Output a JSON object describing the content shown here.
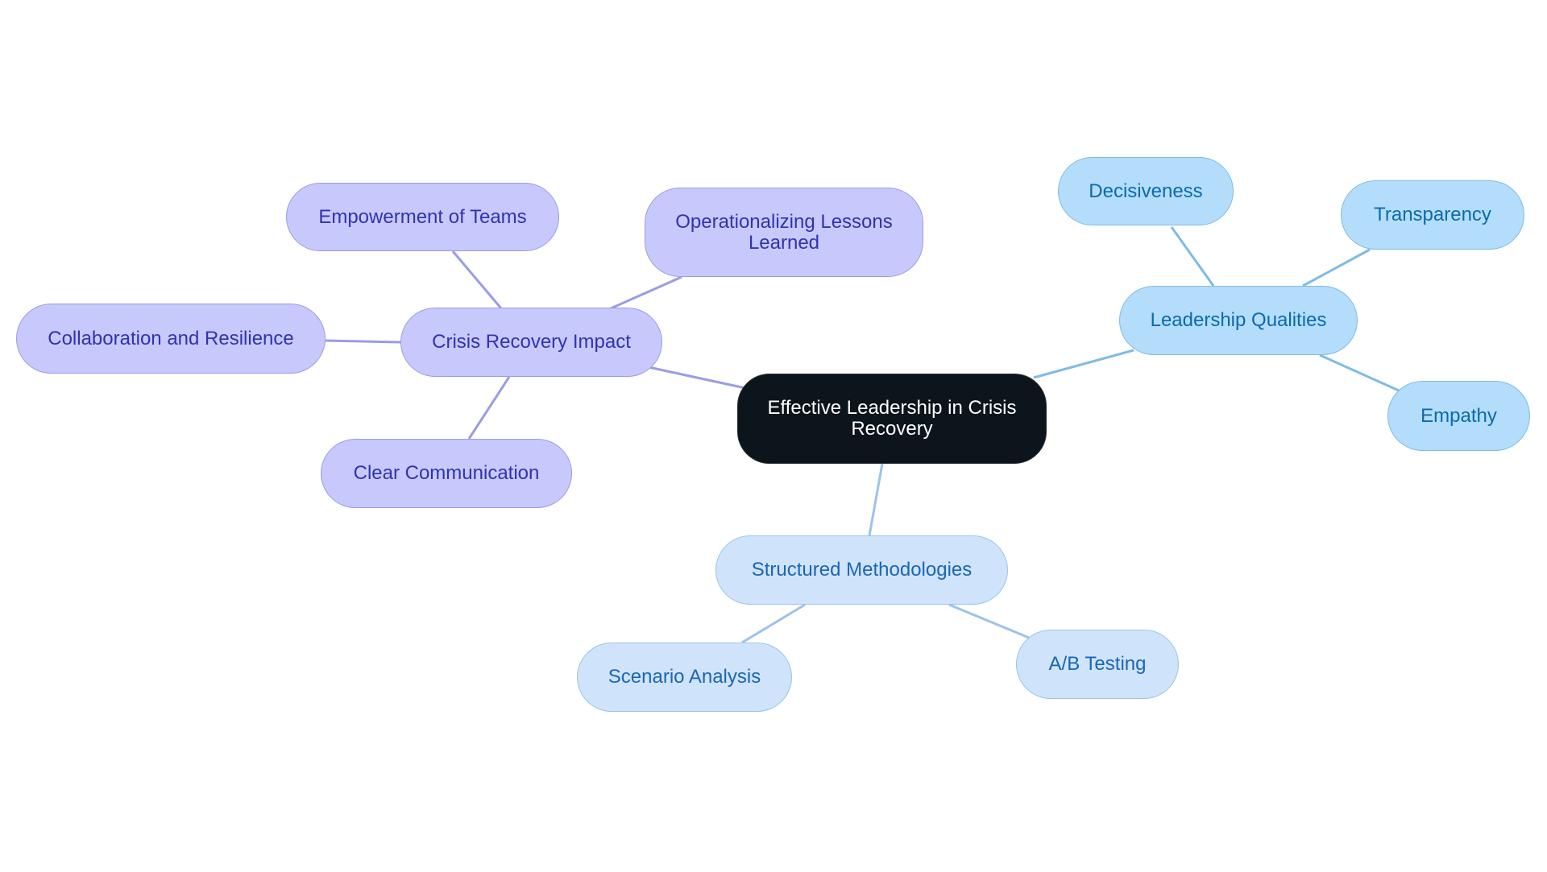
{
  "diagram": {
    "type": "mind-map",
    "root": {
      "id": "root",
      "label": "Effective Leadership in Crisis Recovery",
      "style": "root"
    },
    "colors": {
      "root_fill": "#0c141c",
      "purple_fill": "#c7c9fd",
      "purple_text": "#3033b0",
      "purple_edge": "#9a9ce6",
      "sky_fill": "#b3ddfb",
      "sky_text": "#0c6aad",
      "sky_edge": "#7ebbe6",
      "pale_fill": "#cfe3fb",
      "pale_text": "#1a66b4",
      "pale_edge": "#9cc2ec"
    },
    "nodes": [
      {
        "id": "crisis",
        "label": "Crisis Recovery Impact",
        "parent": "root",
        "style": "purple"
      },
      {
        "id": "empower",
        "label": "Empowerment of Teams",
        "parent": "crisis",
        "style": "purple"
      },
      {
        "id": "oplessons",
        "label": "Operationalizing Lessons Learned",
        "parent": "crisis",
        "style": "purple"
      },
      {
        "id": "collab",
        "label": "Collaboration and Resilience",
        "parent": "crisis",
        "style": "purple"
      },
      {
        "id": "clearcomm",
        "label": "Clear Communication",
        "parent": "crisis",
        "style": "purple"
      },
      {
        "id": "leadq",
        "label": "Leadership Qualities",
        "parent": "root",
        "style": "sky"
      },
      {
        "id": "decisive",
        "label": "Decisiveness",
        "parent": "leadq",
        "style": "sky"
      },
      {
        "id": "transp",
        "label": "Transparency",
        "parent": "leadq",
        "style": "sky"
      },
      {
        "id": "empathy",
        "label": "Empathy",
        "parent": "leadq",
        "style": "sky"
      },
      {
        "id": "structured",
        "label": "Structured Methodologies",
        "parent": "root",
        "style": "pale"
      },
      {
        "id": "scenario",
        "label": "Scenario Analysis",
        "parent": "structured",
        "style": "pale"
      },
      {
        "id": "abtest",
        "label": "A/B Testing",
        "parent": "structured",
        "style": "pale"
      }
    ]
  }
}
